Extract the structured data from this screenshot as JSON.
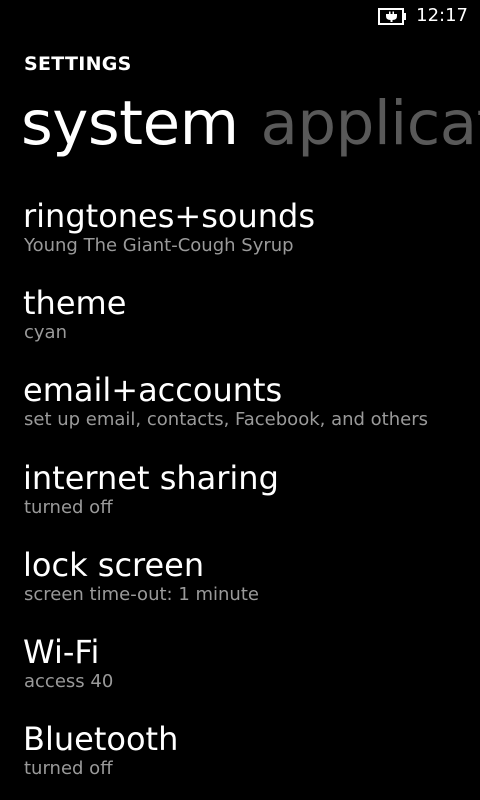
{
  "status_bar": {
    "battery_icon": "battery-charging-icon",
    "time": "12:17"
  },
  "header": {
    "app_title": "SETTINGS",
    "pivots": [
      {
        "label": "system",
        "active": true
      },
      {
        "label": "applications",
        "active": false
      }
    ]
  },
  "settings": [
    {
      "title": "ringtones+sounds",
      "subtitle": "Young The Giant-Cough Syrup"
    },
    {
      "title": "theme",
      "subtitle": "cyan"
    },
    {
      "title": "email+accounts",
      "subtitle": "set up email, contacts, Facebook, and others"
    },
    {
      "title": "internet sharing",
      "subtitle": "turned off"
    },
    {
      "title": "lock screen",
      "subtitle": "screen time-out: 1 minute"
    },
    {
      "title": "Wi-Fi",
      "subtitle": "access 40"
    },
    {
      "title": "Bluetooth",
      "subtitle": "turned off"
    }
  ],
  "colors": {
    "background": "#000000",
    "text_primary": "#ffffff",
    "text_secondary": "#9a9a9a",
    "pivot_inactive": "#595959"
  }
}
